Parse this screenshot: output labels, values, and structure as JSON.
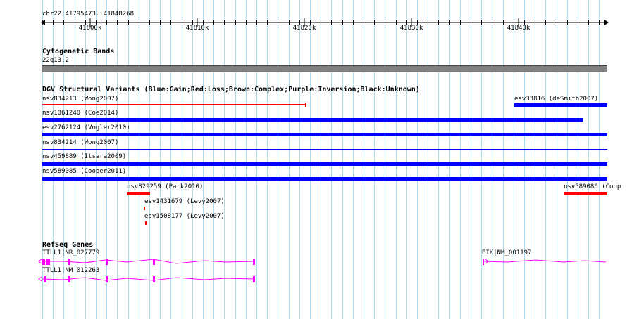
{
  "ruler": {
    "position_label": "chr22:41795473..41848268",
    "ticks": [
      "41800k",
      "41810k",
      "41820k",
      "41830k",
      "41840k"
    ]
  },
  "cytoband": {
    "title": "Cytogenetic Bands",
    "band_label": "22q13.2"
  },
  "dgv": {
    "title": "DGV Structural Variants (Blue:Gain;Red:Loss;Brown:Complex;Purple:Inversion;Black:Unknown)",
    "legend_colors": {
      "gain": "#0000ff",
      "loss": "#ff0000",
      "complex": "#8b4513",
      "inversion": "#800080",
      "unknown": "#000000"
    },
    "variants": [
      {
        "label": "nsv834213 (Wong2007)",
        "type": "loss"
      },
      {
        "label": "esv33816 (deSmith2007)",
        "type": "gain"
      },
      {
        "label": "nsv1061240 (Coe2014)",
        "type": "gain"
      },
      {
        "label": "esv2762124 (Vogler2010)",
        "type": "gain"
      },
      {
        "label": "nsv834214 (Wong2007)",
        "type": "gain"
      },
      {
        "label": "nsv459889 (Itsara2009)",
        "type": "gain"
      },
      {
        "label": "nsv589085 (Cooper2011)",
        "type": "gain"
      },
      {
        "label": "nsv829259 (Park2010)",
        "type": "loss"
      },
      {
        "label": "nsv589086 (Coop",
        "type": "loss"
      },
      {
        "label": "esv1431679 (Levy2007)",
        "type": "loss"
      },
      {
        "label": "esv1508177 (Levy2007)",
        "type": "loss"
      }
    ]
  },
  "refseq": {
    "title": "RefSeq Genes",
    "gene_color": "#ff00ff",
    "genes": [
      {
        "label": "TTLL1|NR_027779"
      },
      {
        "label": "TTLL1|NM_012263"
      },
      {
        "label": "BIK|NM_001197"
      }
    ]
  }
}
